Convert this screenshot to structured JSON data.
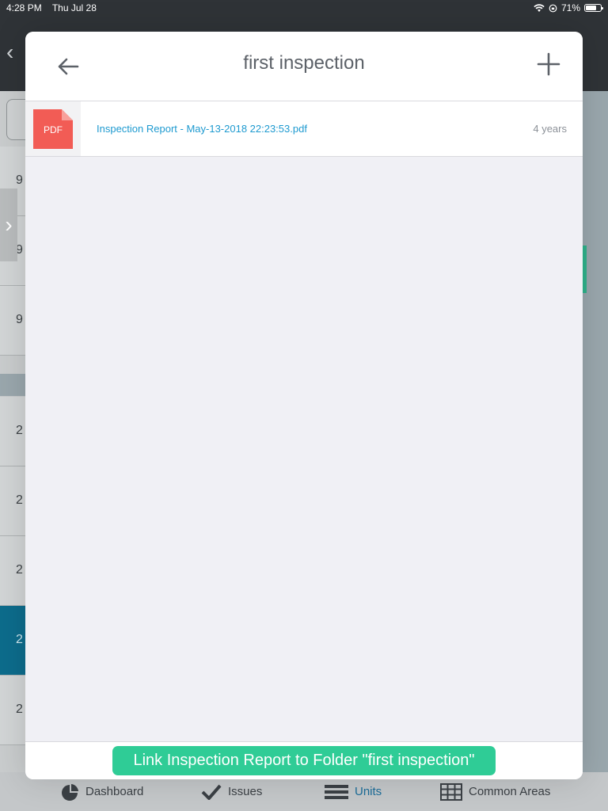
{
  "status": {
    "time": "4:28 PM",
    "date": "Thu Jul 28",
    "battery": "71%",
    "battery_level": 0.71
  },
  "background": {
    "rows": [
      {
        "num": "9"
      },
      {
        "num": "9"
      },
      {
        "num": "9"
      },
      {
        "num": "2"
      },
      {
        "num": "2"
      },
      {
        "num": "2"
      },
      {
        "num": "2"
      },
      {
        "num": "2"
      }
    ],
    "selected_index": 6
  },
  "modal": {
    "title": "first inspection",
    "files": [
      {
        "type_label": "PDF",
        "name": "Inspection Report - May-13-2018 22:23:53.pdf",
        "age": "4 years"
      }
    ],
    "link_button_label": "Link Inspection Report to Folder \"first inspection\""
  },
  "tabs": [
    {
      "label": "Dashboard",
      "icon": "dashboard-icon"
    },
    {
      "label": "Issues",
      "icon": "checkmark-icon"
    },
    {
      "label": "Units",
      "icon": "list-icon",
      "active": true
    },
    {
      "label": "Common Areas",
      "icon": "grid-icon"
    }
  ],
  "colors": {
    "accent": "#2fcc96",
    "link": "#1e9ad0",
    "pdf": "#f25c55",
    "selected_row": "#0d6c8c"
  }
}
